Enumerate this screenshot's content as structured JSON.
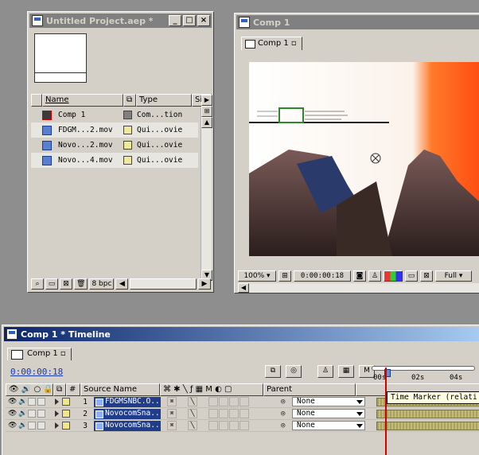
{
  "project_window": {
    "title": "Untitled Project.aep *",
    "columns": [
      "Name",
      "Type",
      "Si"
    ],
    "items": [
      {
        "name": "Comp 1",
        "type": "Com...tion",
        "swatch": "#808080"
      },
      {
        "name": "FDGM...2.mov",
        "type": "Qui...ovie",
        "swatch": "#efe9a0"
      },
      {
        "name": "Novo...2.mov",
        "type": "Qui...ovie",
        "swatch": "#efe9a0"
      },
      {
        "name": "Novo...4.mov",
        "type": "Qui...ovie",
        "swatch": "#efe9a0"
      }
    ],
    "bpc_label": "8 bpc"
  },
  "comp_window": {
    "title": "Comp 1",
    "tab_label": "Comp 1",
    "zoom": "100%",
    "timecode": "0:00:00:18",
    "resolution": "Full"
  },
  "timeline_window": {
    "title": "Comp 1 * Timeline",
    "tab_label": "Comp 1",
    "timecode": "0:00:00:18",
    "columns": {
      "hash": "#",
      "source_name": "Source Name",
      "parent": "Parent"
    },
    "ruler_labels": [
      "00s",
      "02s",
      "04s"
    ],
    "tooltip": "Time Marker (relati",
    "layers": [
      {
        "num": "1",
        "name": "FDGMSNBC.O...",
        "parent": "None"
      },
      {
        "num": "2",
        "name": "NovocomSna...",
        "parent": "None"
      },
      {
        "num": "3",
        "name": "NovocomSna...",
        "parent": "None"
      }
    ]
  },
  "colors": {
    "title_active": "#0a246a",
    "title_inactive": "#808080",
    "face": "#d4d0c8",
    "timecode": "#1c3aa8",
    "playhead": "#d00000"
  }
}
